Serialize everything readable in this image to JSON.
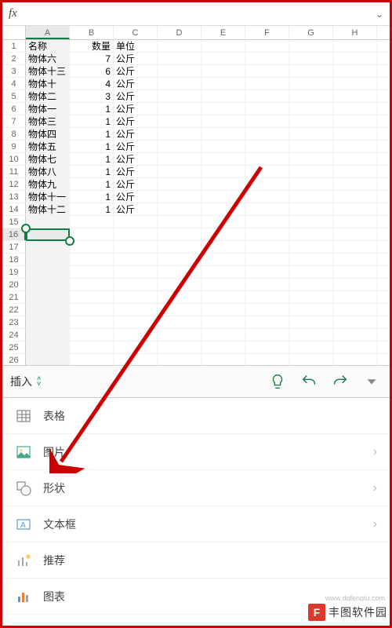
{
  "fx_label": "fx",
  "columns": [
    "A",
    "B",
    "C",
    "D",
    "E",
    "F",
    "G",
    "H"
  ],
  "selected_col": "A",
  "selected_row": 16,
  "headers": {
    "name": "名称",
    "qty": "数量",
    "unit": "单位"
  },
  "rows": [
    {
      "name": "物体六",
      "qty": 7,
      "unit": "公斤"
    },
    {
      "name": "物体十三",
      "qty": 6,
      "unit": "公斤"
    },
    {
      "name": "物体十",
      "qty": 4,
      "unit": "公斤"
    },
    {
      "name": "物体二",
      "qty": 3,
      "unit": "公斤"
    },
    {
      "name": "物体一",
      "qty": 1,
      "unit": "公斤"
    },
    {
      "name": "物体三",
      "qty": 1,
      "unit": "公斤"
    },
    {
      "name": "物体四",
      "qty": 1,
      "unit": "公斤"
    },
    {
      "name": "物体五",
      "qty": 1,
      "unit": "公斤"
    },
    {
      "name": "物体七",
      "qty": 1,
      "unit": "公斤"
    },
    {
      "name": "物体八",
      "qty": 1,
      "unit": "公斤"
    },
    {
      "name": "物体九",
      "qty": 1,
      "unit": "公斤"
    },
    {
      "name": "物体十一",
      "qty": 1,
      "unit": "公斤"
    },
    {
      "name": "物体十二",
      "qty": 1,
      "unit": "公斤"
    }
  ],
  "blank_rows": [
    15,
    16,
    17,
    18,
    19,
    20,
    21,
    22,
    23,
    24,
    25,
    26
  ],
  "toolbar": {
    "tab": "插入"
  },
  "menu": {
    "table": "表格",
    "image": "图片",
    "shape": "形状",
    "textbox": "文本框",
    "recommend": "推荐",
    "chart": "图表"
  },
  "watermark": {
    "f": "F",
    "text": "丰图软件园",
    "url": "www.dgfengtu.com"
  }
}
